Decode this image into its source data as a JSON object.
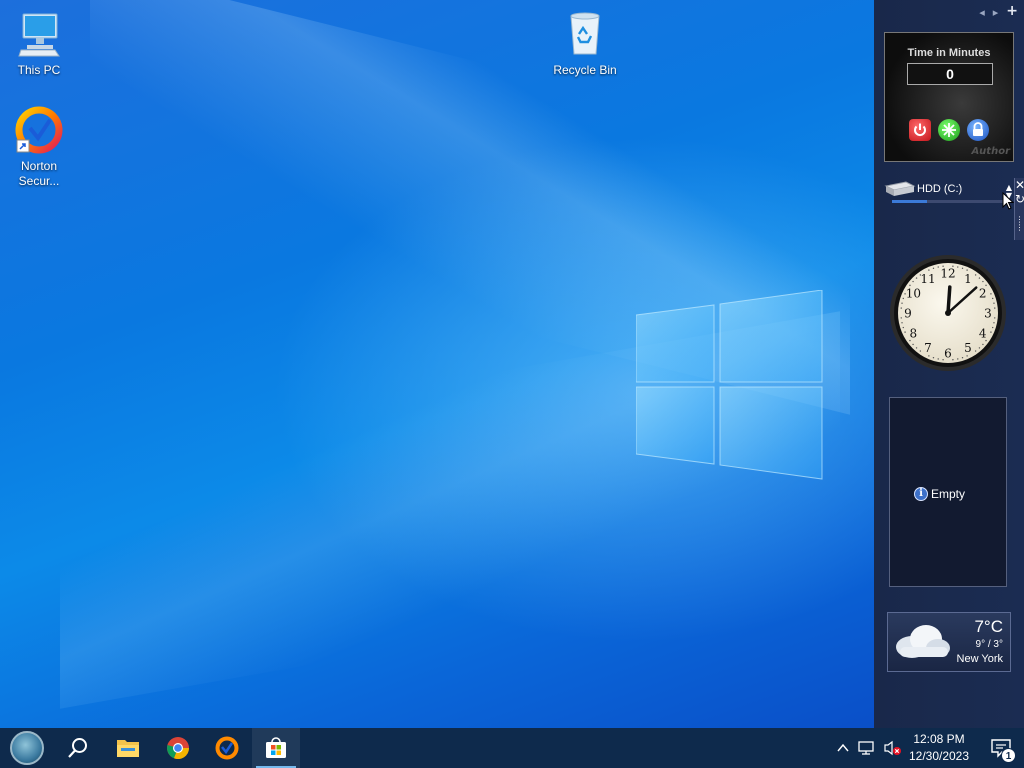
{
  "desktop": {
    "icons": [
      {
        "label": "This PC",
        "icon": "computer-icon"
      },
      {
        "label": "Recycle Bin",
        "icon": "recycle-bin-icon"
      },
      {
        "label": "Norton Secur...",
        "icon": "norton-icon"
      }
    ]
  },
  "sidebar": {
    "controls": {
      "prev": "◂",
      "next": "▸",
      "add": "+"
    },
    "shutdown_gadget": {
      "title": "Time in Minutes",
      "minutes_value": "0",
      "author": "Author",
      "buttons": [
        "power-icon",
        "restart-icon",
        "lock-icon"
      ]
    },
    "hdd_gadget": {
      "drive_label": "HDD (C:)",
      "usage_fraction": 0.3
    },
    "clock_gadget": {
      "hour": 12,
      "minute": 8,
      "numerals": [
        "12",
        "1",
        "2",
        "3",
        "4",
        "5",
        "6",
        "7",
        "8",
        "9",
        "10",
        "11"
      ]
    },
    "empty_gadget": {
      "text": "Empty"
    },
    "weather_gadget": {
      "temperature": "7°C",
      "range": "9° / 3°",
      "city": "New York",
      "condition_icon": "cloud-icon"
    }
  },
  "taskbar": {
    "apps": [
      "start-orb",
      "search-icon",
      "file-explorer-icon",
      "chrome-icon",
      "norton-icon",
      "microsoft-store-icon"
    ],
    "active_app": "microsoft-store-icon",
    "tray": {
      "icons": [
        "chevron-up-icon",
        "network-icon",
        "volume-muted-icon"
      ],
      "time": "12:08 PM",
      "date": "12/30/2023",
      "notification_count": "1"
    }
  },
  "colors": {
    "taskbar_bg": "#0e2a4c",
    "sidebar_bg": "#1b2c52",
    "accent": "#76b9ed"
  }
}
